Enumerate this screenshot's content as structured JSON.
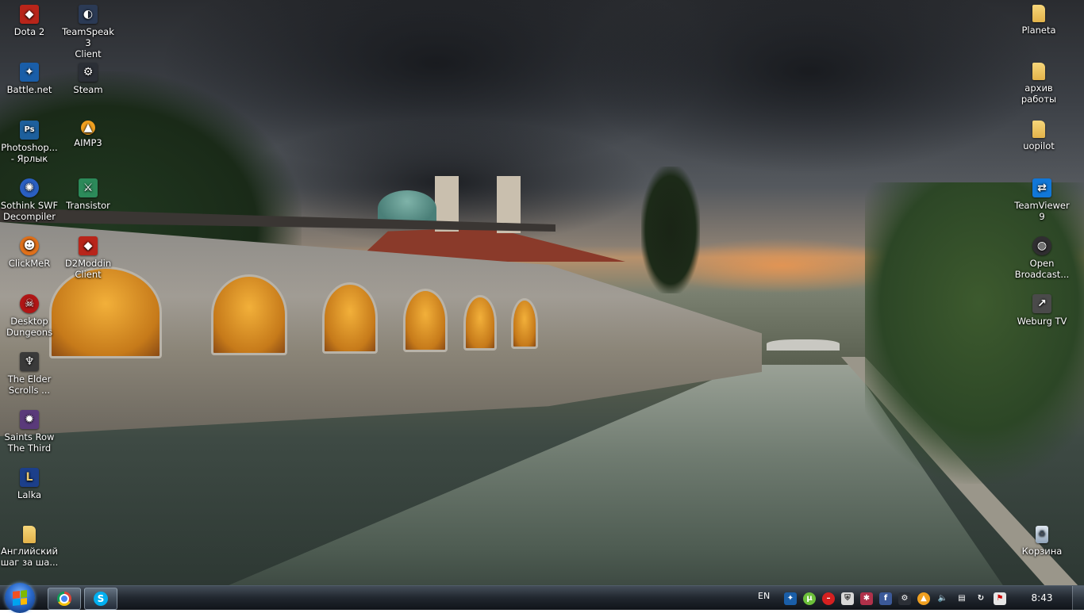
{
  "desktop_icons": {
    "dota2": {
      "label": "Dota 2",
      "icon": "dota-2-icon",
      "color": "#b8251a"
    },
    "teamspeak": {
      "label": "TeamSpeak 3\nClient",
      "icon": "teamspeak-icon",
      "color": "#2b3a55"
    },
    "battlenet": {
      "label": "Battle.net",
      "icon": "battlenet-icon",
      "color": "#1a5ea8"
    },
    "steam": {
      "label": "Steam",
      "icon": "steam-icon",
      "color": "#2b2f36"
    },
    "photoshop": {
      "label": "Photoshop...\n- Ярлык",
      "icon": "photoshop-icon",
      "color": "#1d5f9c"
    },
    "aimp": {
      "label": "AIMP3",
      "icon": "aimp-icon",
      "color": "#f0a020"
    },
    "sothink": {
      "label": "Sothink SWF\nDecompiler",
      "icon": "sothink-icon",
      "color": "#2a5fc2"
    },
    "transistor": {
      "label": "Transistor",
      "icon": "transistor-icon",
      "color": "#2c8a5a"
    },
    "clickmer": {
      "label": "ClickMeR",
      "icon": "pumpkin-icon",
      "color": "#e0701a"
    },
    "d2moddin": {
      "label": "D2Moddin\nClient",
      "icon": "d2moddin-icon",
      "color": "#b8251a"
    },
    "desktop_dungeons": {
      "label": "Desktop\nDungeons",
      "icon": "desktop-dungeons-icon",
      "color": "#b01616"
    },
    "elder_scrolls": {
      "label": "The Elder\nScrolls ...",
      "icon": "skyrim-icon",
      "color": "#3a3a3a"
    },
    "saints_row": {
      "label": "Saints Row\nThe Third",
      "icon": "saints-row-icon",
      "color": "#5a3a7a"
    },
    "lalka": {
      "label": "Lalka",
      "icon": "league-icon",
      "color": "#1c3f8a"
    },
    "english": {
      "label": "Английский\nшаг за ша...",
      "icon": "folder-icon",
      "color": "#e3b34a"
    },
    "planeta": {
      "label": "Planeta",
      "icon": "folder-icon",
      "color": "#e3b34a"
    },
    "archive": {
      "label": "архив\nработы",
      "icon": "folder-icon",
      "color": "#e3b34a"
    },
    "uopilot": {
      "label": "uopilot",
      "icon": "folder-icon",
      "color": "#e3b34a"
    },
    "teamviewer": {
      "label": "TeamViewer\n9",
      "icon": "teamviewer-icon",
      "color": "#1177d8"
    },
    "obs": {
      "label": "Open\nBroadcast...",
      "icon": "obs-icon",
      "color": "#302e31"
    },
    "weburg": {
      "label": "Weburg TV",
      "icon": "weburg-icon",
      "color": "#4a4a4a"
    },
    "recycle_bin": {
      "label": "Корзина",
      "icon": "recycle-bin-icon",
      "color": "#a9b8c8"
    }
  },
  "taskbar": {
    "pinned": [
      {
        "name": "Google Chrome",
        "icon": "chrome-icon"
      },
      {
        "name": "Skype",
        "icon": "skype-icon"
      }
    ],
    "language": "EN",
    "tray_icons": [
      "battlenet-icon",
      "utorrent-icon",
      "no-entry-icon",
      "shield-icon",
      "network-spider-icon",
      "facebook-icon",
      "steam-icon",
      "aimp-icon",
      "volume-icon",
      "network-icon",
      "sync-icon",
      "action-center-flag-icon"
    ],
    "clock": "8:43"
  }
}
